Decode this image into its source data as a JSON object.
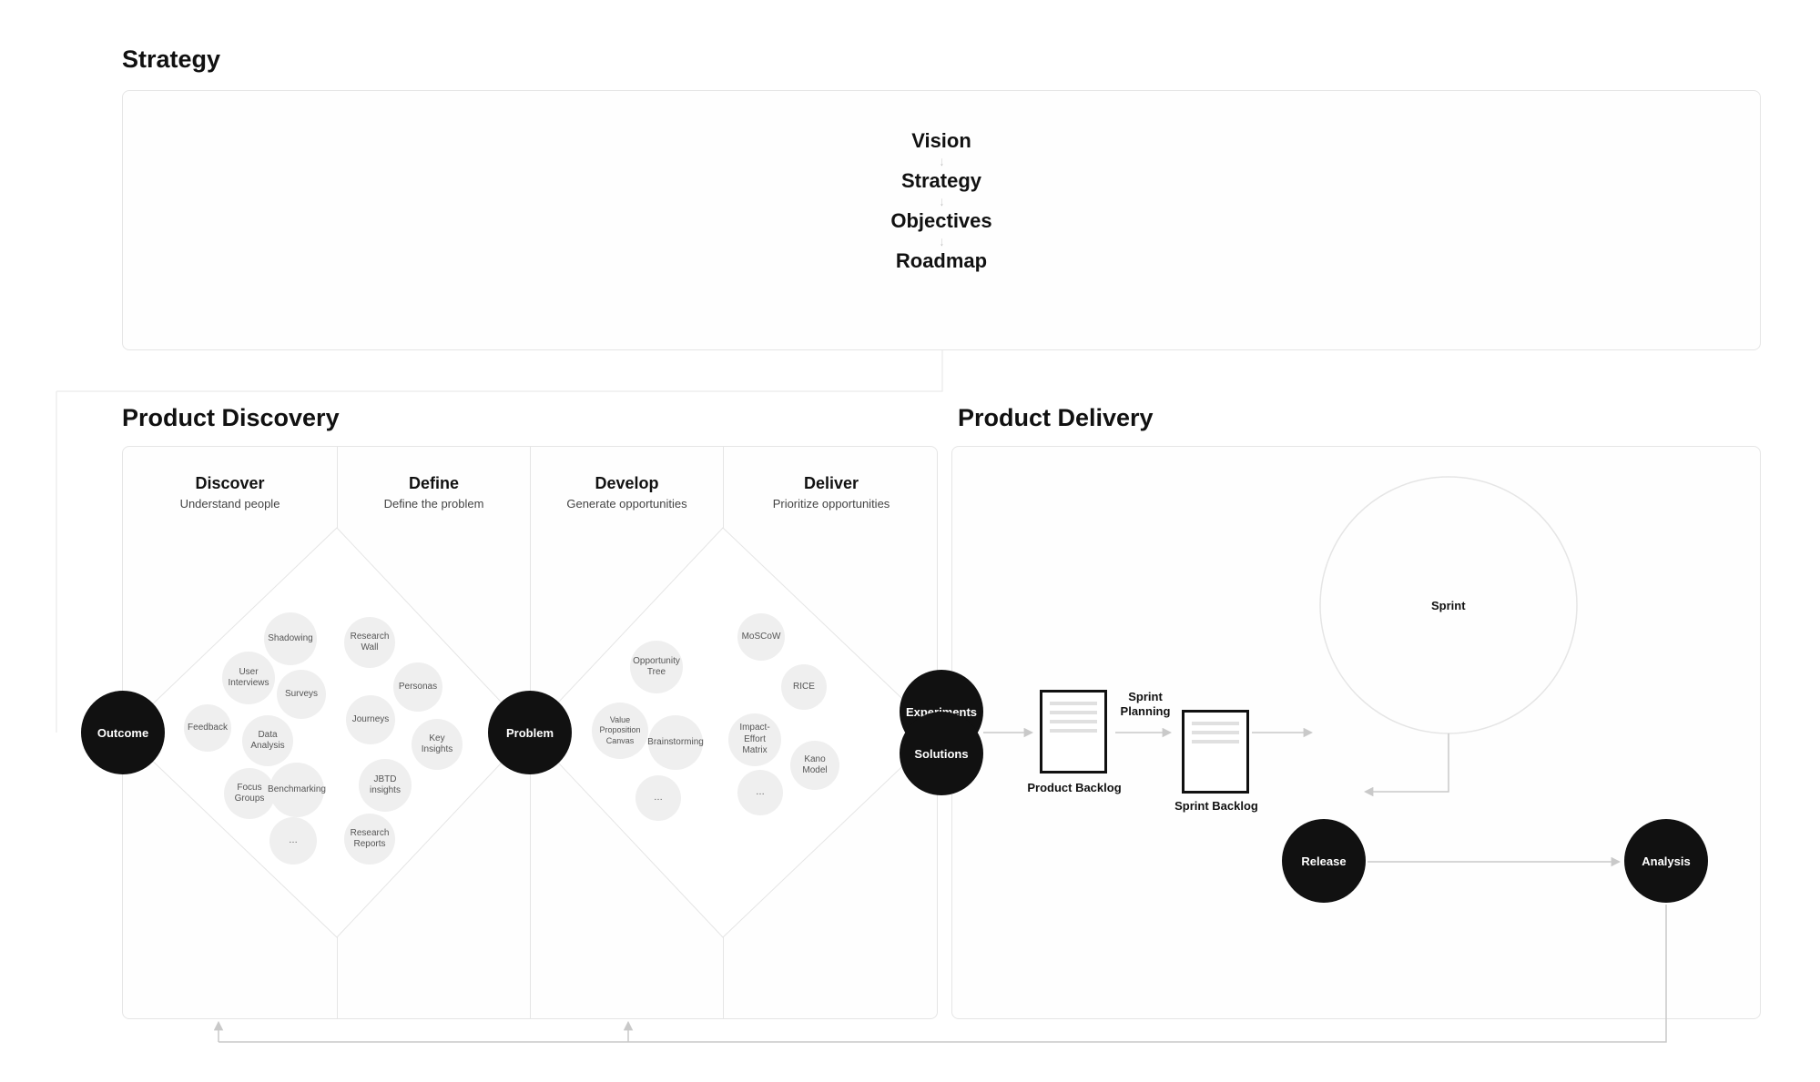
{
  "sections": {
    "strategy": "Strategy",
    "discovery": "Product Discovery",
    "delivery": "Product Delivery"
  },
  "strategy_chain": [
    "Vision",
    "Strategy",
    "Objectives",
    "Roadmap"
  ],
  "discovery_phases": [
    {
      "title": "Discover",
      "subtitle": "Understand people"
    },
    {
      "title": "Define",
      "subtitle": "Define the problem"
    },
    {
      "title": "Develop",
      "subtitle": "Generate opportunities"
    },
    {
      "title": "Deliver",
      "subtitle": "Prioritize opportunities"
    }
  ],
  "black_nodes": {
    "outcome": "Outcome",
    "problem": "Problem",
    "experiments": "Experiments",
    "solutions": "Solutions",
    "release": "Release",
    "analysis": "Analysis"
  },
  "bubbles": {
    "discover": [
      "Shadowing",
      "User Interviews",
      "Surveys",
      "Feedback",
      "Data Analysis",
      "Focus Groups",
      "Benchmarking",
      "…"
    ],
    "define": [
      "Research Wall",
      "Personas",
      "Journeys",
      "Key Insights",
      "JBTD insights",
      "Research Reports"
    ],
    "develop": [
      "Opportunity Tree",
      "Value Proposition Canvas",
      "Brainstorming",
      "…"
    ],
    "deliver": [
      "MoSCoW",
      "RICE",
      "Impact-Effort Matrix",
      "Kano Model",
      "…"
    ]
  },
  "delivery": {
    "product_backlog": "Product Backlog",
    "sprint_planning": "Sprint Planning",
    "sprint_backlog": "Sprint Backlog",
    "sprint": "Sprint"
  }
}
